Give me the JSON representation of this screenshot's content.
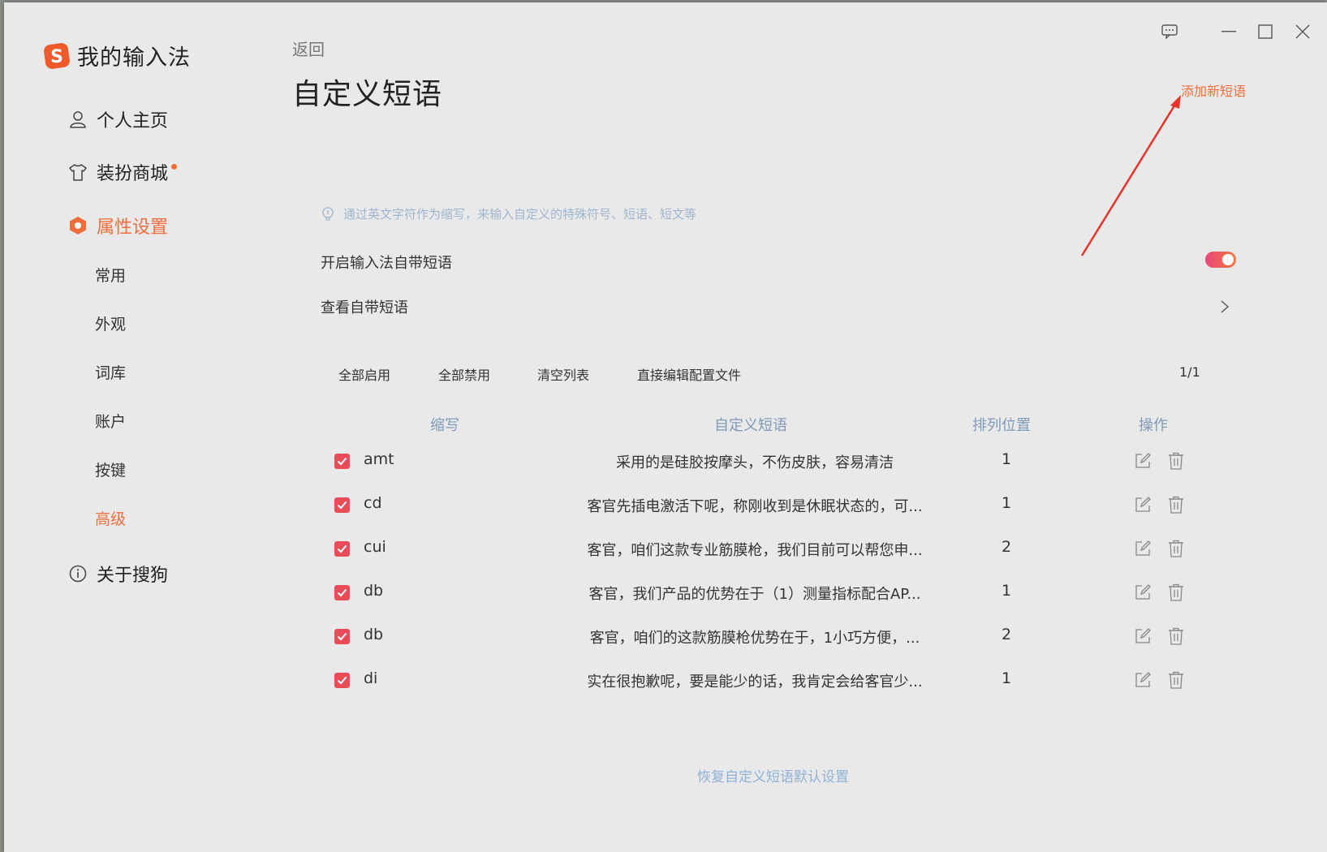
{
  "app": {
    "title": "我的输入法"
  },
  "sidebar": {
    "items": [
      {
        "label": "个人主页",
        "icon": "user-icon"
      },
      {
        "label": "装扮商城",
        "icon": "shirt-icon",
        "has_dot": true
      },
      {
        "label": "属性设置",
        "icon": "settings-hexagon-icon",
        "active": true
      },
      {
        "label": "关于搜狗",
        "icon": "info-icon"
      }
    ],
    "sub_items": [
      {
        "label": "常用"
      },
      {
        "label": "外观"
      },
      {
        "label": "词库"
      },
      {
        "label": "账户"
      },
      {
        "label": "按键"
      },
      {
        "label": "高级",
        "active": true
      }
    ]
  },
  "main": {
    "back_label": "返回",
    "title": "自定义短语",
    "add_label": "添加新短语",
    "hint": "通过英文字符作为缩写，来输入自定义的特殊符号、短语、短文等",
    "enable_label": "开启输入法自带短语",
    "enable_on": true,
    "view_label": "查看自带短语",
    "toolbar": {
      "enable_all": "全部启用",
      "disable_all": "全部禁用",
      "clear_list": "清空列表",
      "edit_config": "直接编辑配置文件",
      "page": "1/1"
    },
    "table": {
      "headers": {
        "abbr": "缩写",
        "phrase": "自定义短语",
        "position": "排列位置",
        "action": "操作"
      },
      "rows": [
        {
          "abbr": "amt",
          "phrase": "采用的是硅胶按摩头，不伤皮肤，容易清洁",
          "position": "1",
          "checked": true
        },
        {
          "abbr": "cd",
          "phrase": "客官先插电激活下呢，称刚收到是休眠状态的，可...",
          "position": "1",
          "checked": true
        },
        {
          "abbr": "cui",
          "phrase": "客官，咱们这款专业筋膜枪，我们目前可以帮您申...",
          "position": "2",
          "checked": true
        },
        {
          "abbr": "db",
          "phrase": "客官，我们产品的优势在于（1）测量指标配合AP...",
          "position": "1",
          "checked": true
        },
        {
          "abbr": "db",
          "phrase": "客官，咱们的这款筋膜枪优势在于，1小巧方便，...",
          "position": "2",
          "checked": true
        },
        {
          "abbr": "di",
          "phrase": "实在很抱歉呢，要是能少的话，我肯定会给客官少...",
          "position": "1",
          "checked": true
        }
      ]
    },
    "restore_label": "恢复自定义短语默认设置"
  },
  "colors": {
    "accent": "#ee6d3a",
    "checkbox": "#e94c56",
    "link": "#8fb2d6",
    "arrow": "#e8322b"
  }
}
